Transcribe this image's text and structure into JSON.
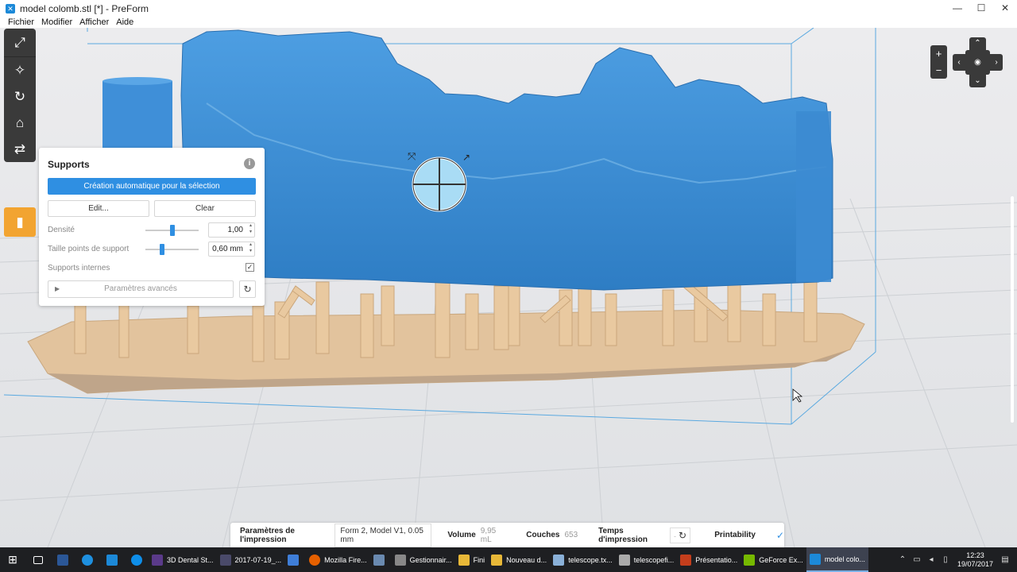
{
  "window": {
    "title": "model colomb.stl [*] - PreForm",
    "minimize": "—",
    "maximize": "☐",
    "close": "✕"
  },
  "menu": [
    "Fichier",
    "Modifier",
    "Afficher",
    "Aide"
  ],
  "toolbar": {
    "tools": [
      "expand-icon",
      "magic-wand-icon",
      "rotate-icon",
      "supports-icon",
      "layout-icon"
    ],
    "active_tool": "printer-icon"
  },
  "supports_panel": {
    "title": "Supports",
    "auto_generate": "Création automatique pour la sélection",
    "edit": "Edit...",
    "clear": "Clear",
    "density_label": "Densité",
    "density_value": "1,00",
    "density_level": 0.5,
    "touchpoint_label": "Taille points de support",
    "touchpoint_value": "0,60 mm",
    "touchpoint_level": 0.3,
    "internal_label": "Supports internes",
    "internal_checked": true,
    "advanced": "Paramètres avancés"
  },
  "print_bar": {
    "settings_label": "Paramètres de l'impression",
    "settings_value": "Form 2, Model V1, 0.05 mm",
    "volume_label": "Volume",
    "volume_value": "9,95 mL",
    "layers_label": "Couches",
    "layers_value": "653",
    "time_label": "Temps d'impression",
    "time_value": "-",
    "printability_label": "Printability"
  },
  "taskbar": {
    "apps": [
      {
        "label": "3D Dental St...",
        "color": "#5a3a8a"
      },
      {
        "label": "2017-07-19_...",
        "color": "#4a4a6a"
      },
      {
        "label": "",
        "color": "#3f7ed8"
      },
      {
        "label": "Mozilla Fire...",
        "color": "#e66000"
      },
      {
        "label": "",
        "color": "#6a8ab0"
      },
      {
        "label": "Gestionnair...",
        "color": "#888888"
      },
      {
        "label": "Fini",
        "color": "#e8b838"
      },
      {
        "label": "Nouveau d...",
        "color": "#e8b838"
      },
      {
        "label": "telescope.tx...",
        "color": "#8ab0d8"
      },
      {
        "label": "telescopefi...",
        "color": "#aaaaaa"
      },
      {
        "label": "Présentatio...",
        "color": "#c43e1c"
      },
      {
        "label": "GeForce Ex...",
        "color": "#76b900"
      },
      {
        "label": "model colo...",
        "color": "#1c89d8"
      }
    ],
    "time": "12:23",
    "date": "19/07/2017"
  },
  "colors": {
    "model": "#3d8fd6",
    "supports": "#e9c9a0",
    "accent": "#2f8fe2",
    "active_tool": "#f2a431"
  }
}
